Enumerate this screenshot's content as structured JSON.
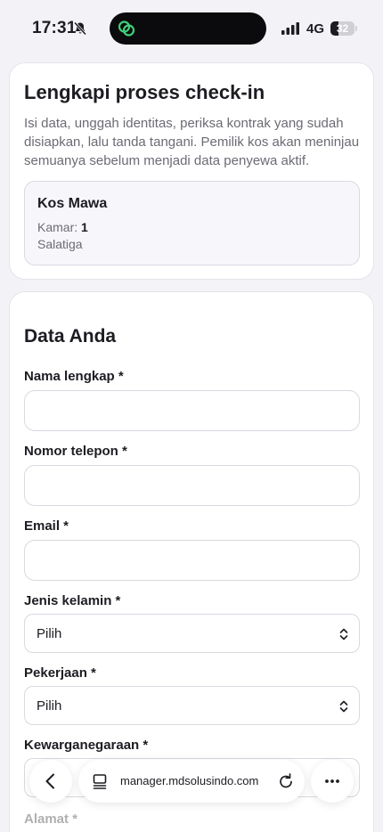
{
  "status_bar": {
    "time": "17:31",
    "network": "4G",
    "battery": "32",
    "battery_level_percent": 32
  },
  "checkin": {
    "title": "Lengkapi proses check-in",
    "description": "Isi data, unggah identitas, periksa kontrak yang sudah disiapkan, lalu tanda tangani. Pemilik kos akan meninjau semuanya sebelum menjadi data penyewa aktif.",
    "kos": {
      "name": "Kos Mawa",
      "room_label": "Kamar:",
      "room_number": "1",
      "city": "Salatiga"
    }
  },
  "form": {
    "section_title": "Data Anda",
    "full_name": {
      "label": "Nama lengkap *",
      "value": ""
    },
    "phone": {
      "label": "Nomor telepon *",
      "value": ""
    },
    "email": {
      "label": "Email *",
      "value": ""
    },
    "gender": {
      "label": "Jenis kelamin *",
      "selected": "Pilih"
    },
    "job": {
      "label": "Pekerjaan *",
      "selected": "Pilih"
    },
    "citizenship": {
      "label": "Kewarganegaraan *"
    },
    "address": {
      "label": "Alamat *"
    }
  },
  "browser": {
    "url": "manager.mdsolusindo.com"
  },
  "colors": {
    "background": "#f3f3f7",
    "card": "#ffffff",
    "border": "#d9d9e1",
    "text": "#1c1c22",
    "muted": "#6b6b74",
    "island_accent": "#3fd07a"
  }
}
